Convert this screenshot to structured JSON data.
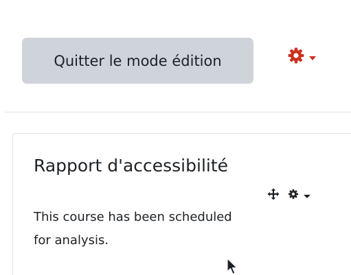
{
  "header": {
    "edit_mode_button_label": "Quitter le mode édition",
    "settings_icon": "gear-icon",
    "settings_dropdown_icon": "chevron-down-icon"
  },
  "block": {
    "title": "Rapport d'accessibilité",
    "message": "This course has been scheduled for analysis.",
    "move_icon": "move-icon",
    "actions_icon": "gear-icon",
    "actions_dropdown_icon": "chevron-down-icon"
  },
  "colors": {
    "button_background": "#ced4da",
    "accent_red": "#ca3120",
    "text": "#1d2125",
    "border": "#dee2e6"
  }
}
